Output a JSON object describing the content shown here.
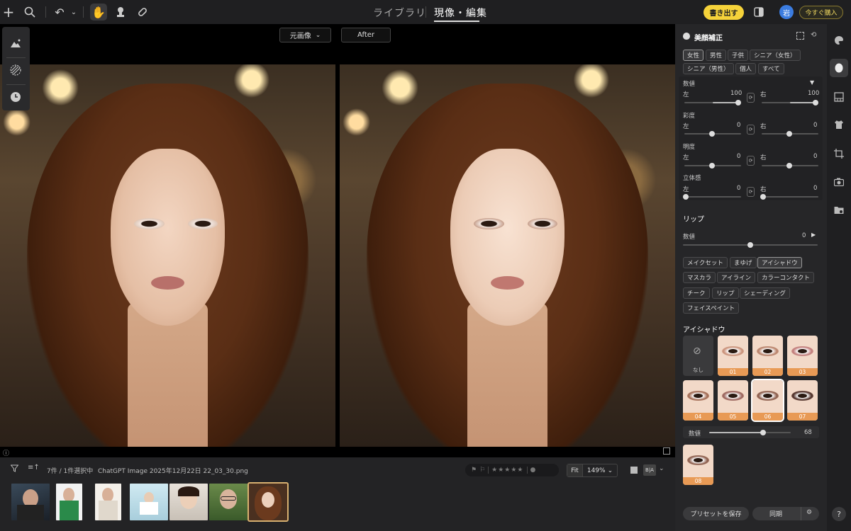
{
  "topbar": {
    "tab_library": "ライブラリ",
    "tab_develop": "現像・編集",
    "export_label": "書き出す",
    "avatar_initial": "岩",
    "buy_label": "今すぐ購入"
  },
  "compare": {
    "before_select": "元画像",
    "after_label": "After"
  },
  "filmstrip": {
    "count_text": "7件 / 1件選択中",
    "filename": "ChatGPT Image 2025年12月22日 22_03_30.png",
    "fit_label": "Fit",
    "zoom_value": "149%",
    "rating_stars": "★★★★★"
  },
  "panel": {
    "title": "美顔補正",
    "target_chips": [
      "女性",
      "男性",
      "子供",
      "シニア（女性）",
      "シニア（男性）",
      "個人",
      "すべて"
    ],
    "values_heading": "数値",
    "params": [
      {
        "name": "",
        "left_label": "左",
        "left_value": "100",
        "right_label": "右",
        "right_value": "100"
      },
      {
        "name": "彩度",
        "left_label": "左",
        "left_value": "0",
        "right_label": "右",
        "right_value": "0"
      },
      {
        "name": "明度",
        "left_label": "左",
        "left_value": "0",
        "right_label": "右",
        "right_value": "0"
      },
      {
        "name": "立体感",
        "left_label": "左",
        "left_value": "0",
        "right_label": "右",
        "right_value": "0"
      }
    ],
    "lip_heading": "リップ",
    "lip_value_label": "数値",
    "lip_value": "0",
    "makeup_chips": [
      "メイクセット",
      "まゆげ",
      "アイシャドウ",
      "マスカラ",
      "アイライン",
      "カラーコンタクト",
      "チーク",
      "リップ",
      "シェーディング",
      "フェイスペイント"
    ],
    "eyeshadow_heading": "アイシャドウ",
    "eyeshadow_tiles": [
      "なし",
      "01",
      "02",
      "03",
      "04",
      "05",
      "06",
      "07"
    ],
    "eyeshadow_value_label": "数値",
    "eyeshadow_value": "68",
    "custom_tile": "08",
    "save_preset": "プリセットを保存",
    "sync": "同期"
  },
  "colors": {
    "accent": "#f5d23a",
    "eyeshadow_label": "#e89a55",
    "avatar": "#3b7ce0"
  }
}
